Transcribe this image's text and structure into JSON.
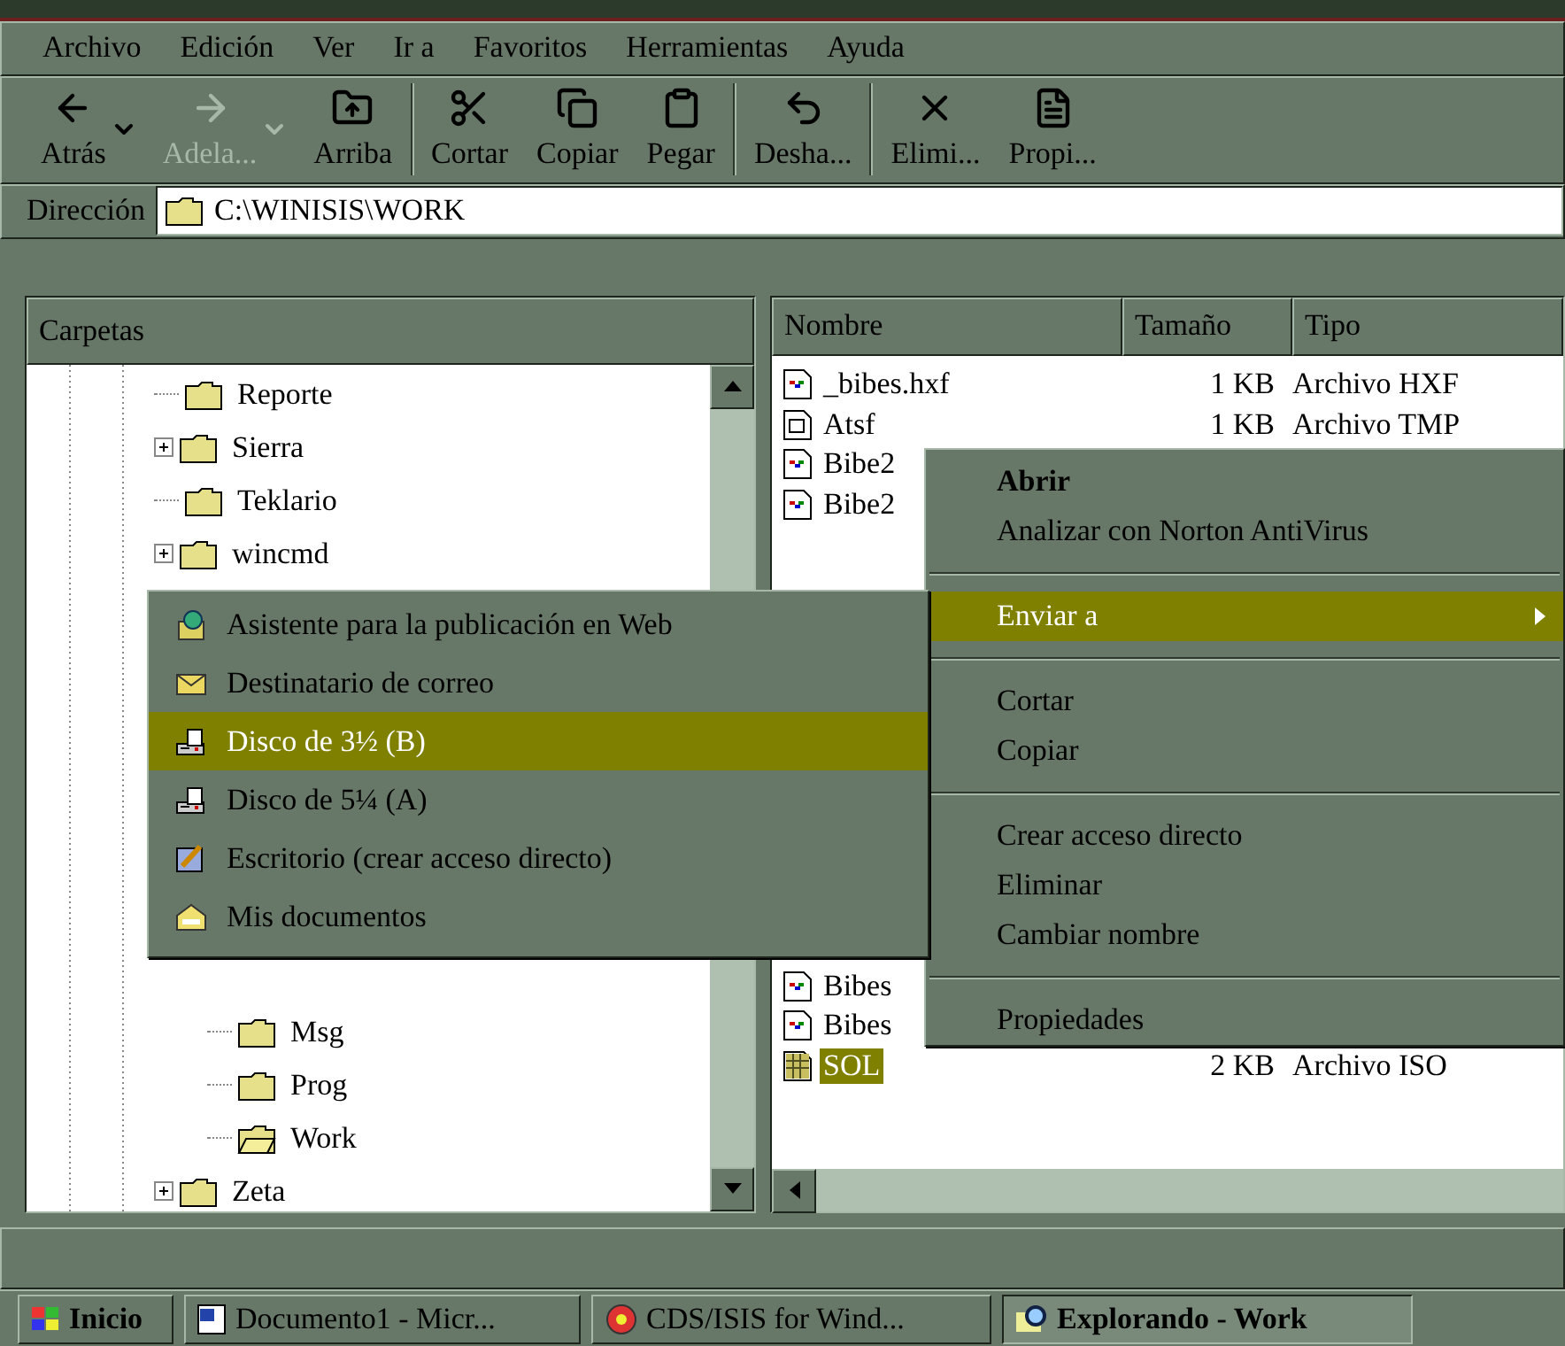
{
  "menu_bar": [
    "Archivo",
    "Edición",
    "Ver",
    "Ir a",
    "Favoritos",
    "Herramientas",
    "Ayuda"
  ],
  "toolbar": [
    {
      "kind": "button",
      "label": "Atrás",
      "dropdown": true,
      "disabled": false
    },
    {
      "kind": "button",
      "label": "Adela...",
      "dropdown": true,
      "disabled": true
    },
    {
      "kind": "button",
      "label": "Arriba",
      "dropdown": false,
      "disabled": false
    },
    {
      "kind": "separator"
    },
    {
      "kind": "button",
      "label": "Cortar",
      "dropdown": false,
      "disabled": false
    },
    {
      "kind": "button",
      "label": "Copiar",
      "dropdown": false,
      "disabled": false
    },
    {
      "kind": "button",
      "label": "Pegar",
      "dropdown": false,
      "disabled": false
    },
    {
      "kind": "separator"
    },
    {
      "kind": "button",
      "label": "Desha...",
      "dropdown": false,
      "disabled": false
    },
    {
      "kind": "separator"
    },
    {
      "kind": "button",
      "label": "Elimi...",
      "dropdown": false,
      "disabled": false
    },
    {
      "kind": "button",
      "label": "Propi...",
      "dropdown": false,
      "disabled": false
    }
  ],
  "address": {
    "label": "Dirección",
    "value": "C:\\WINISIS\\WORK"
  },
  "folders_pane": {
    "title": "Carpetas",
    "tree": [
      {
        "kind": "folder",
        "label": "Reporte",
        "expandable": false
      },
      {
        "kind": "folder",
        "label": "Sierra",
        "expandable": true
      },
      {
        "kind": "folder",
        "label": "Teklario",
        "expandable": false
      },
      {
        "kind": "folder",
        "label": "wincmd",
        "expandable": true
      },
      {
        "kind": "covered"
      },
      {
        "kind": "covered"
      },
      {
        "kind": "covered"
      },
      {
        "kind": "covered"
      },
      {
        "kind": "covered"
      },
      {
        "kind": "covered"
      },
      {
        "kind": "covered"
      },
      {
        "kind": "covered",
        "children": [
          {
            "kind": "folder",
            "label": "Msg",
            "expandable": false,
            "selected": false
          },
          {
            "kind": "folder",
            "label": "Prog",
            "expandable": false,
            "selected": false
          },
          {
            "kind": "folder",
            "label": "Work",
            "expandable": false,
            "selected": true
          }
        ]
      },
      {
        "kind": "folder",
        "label": "Zeta",
        "expandable": true
      }
    ]
  },
  "file_list": {
    "columns": [
      "Nombre",
      "Tamaño",
      "Tipo"
    ],
    "rows": [
      {
        "kind": "linked",
        "name": "_bibes.hxf",
        "size": "1 KB",
        "type": "Archivo HXF",
        "selected": false
      },
      {
        "kind": "document",
        "name": "Atsf",
        "size": "1 KB",
        "type": "Archivo TMP",
        "selected": false
      },
      {
        "kind": "linked",
        "name": "Bibe2",
        "selected": false
      },
      {
        "kind": "linked",
        "name": "Bibe2",
        "selected": false
      },
      {
        "kind": "covered"
      },
      {
        "kind": "covered"
      },
      {
        "kind": "covered"
      },
      {
        "kind": "covered"
      },
      {
        "kind": "covered"
      },
      {
        "kind": "covered"
      },
      {
        "kind": "covered"
      },
      {
        "kind": "covered"
      },
      {
        "kind": "covered"
      },
      {
        "kind": "covered"
      },
      {
        "kind": "covered"
      },
      {
        "kind": "linked",
        "name": "Bibes",
        "selected": false
      },
      {
        "kind": "linked",
        "name": "Bibes",
        "selected": false
      },
      {
        "kind": "grid",
        "name": "SOL",
        "size": "2 KB",
        "type": "Archivo ISO",
        "selected": true
      }
    ]
  },
  "context_menu": [
    {
      "kind": "item",
      "label": "Abrir",
      "bold": true,
      "selected": false
    },
    {
      "kind": "item",
      "label": "Analizar con Norton AntiVirus",
      "bold": false,
      "selected": false
    },
    {
      "kind": "separator"
    },
    {
      "kind": "submenu",
      "label": "Enviar a",
      "bold": false,
      "selected": true
    },
    {
      "kind": "separator"
    },
    {
      "kind": "item",
      "label": "Cortar",
      "bold": false,
      "selected": false
    },
    {
      "kind": "item",
      "label": "Copiar",
      "bold": false,
      "selected": false
    },
    {
      "kind": "separator"
    },
    {
      "kind": "item",
      "label": "Crear acceso directo",
      "bold": false,
      "selected": false
    },
    {
      "kind": "item",
      "label": "Eliminar",
      "bold": false,
      "selected": false
    },
    {
      "kind": "item",
      "label": "Cambiar nombre",
      "bold": false,
      "selected": false
    },
    {
      "kind": "separator"
    },
    {
      "kind": "item",
      "label": "Propiedades",
      "bold": false,
      "selected": false
    }
  ],
  "send_to_menu": [
    {
      "label": "Asistente para la publicación en Web",
      "selected": false
    },
    {
      "label": "Destinatario de correo",
      "selected": false
    },
    {
      "label": "Disco de 3½ (B)",
      "selected": true
    },
    {
      "label": "Disco de 5¼ (A)",
      "selected": false
    },
    {
      "label": "Escritorio (crear acceso directo)",
      "selected": false
    },
    {
      "label": "Mis documentos",
      "selected": false
    }
  ],
  "taskbar": [
    {
      "kind": "start",
      "label": "Inicio",
      "selected": false
    },
    {
      "kind": "task",
      "label": "Documento1 - Micr...",
      "selected": false
    },
    {
      "kind": "task",
      "label": "CDS/ISIS for Wind...",
      "selected": false
    },
    {
      "kind": "task",
      "label": "Explorando - Work",
      "selected": true
    }
  ]
}
